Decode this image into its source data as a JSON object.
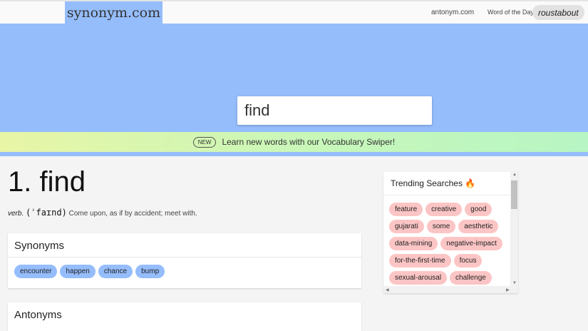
{
  "header": {
    "logo": "synonym.com",
    "antonym_link": "antonym.com",
    "wotd_label": "Word of the Day:",
    "wotd": "roustabout"
  },
  "search": {
    "value": "find"
  },
  "banner": {
    "badge": "NEW",
    "text": "Learn new words with our Vocabulary Swiper!"
  },
  "entry": {
    "title": "1. find",
    "pos": "verb.",
    "pronunciation": "(ˈfaɪnd)",
    "definition": "Come upon, as if by accident; meet with."
  },
  "synonyms": {
    "heading": "Synonyms",
    "items": [
      "encounter",
      "happen",
      "chance",
      "bump"
    ]
  },
  "antonyms": {
    "heading": "Antonyms"
  },
  "trending": {
    "heading": "Trending Searches 🔥",
    "items": [
      "feature",
      "creative",
      "good",
      "gujarati",
      "some",
      "aesthetic",
      "data-mining",
      "negative-impact",
      "for-the-first-time",
      "focus",
      "sexual-arousal",
      "challenge"
    ]
  }
}
